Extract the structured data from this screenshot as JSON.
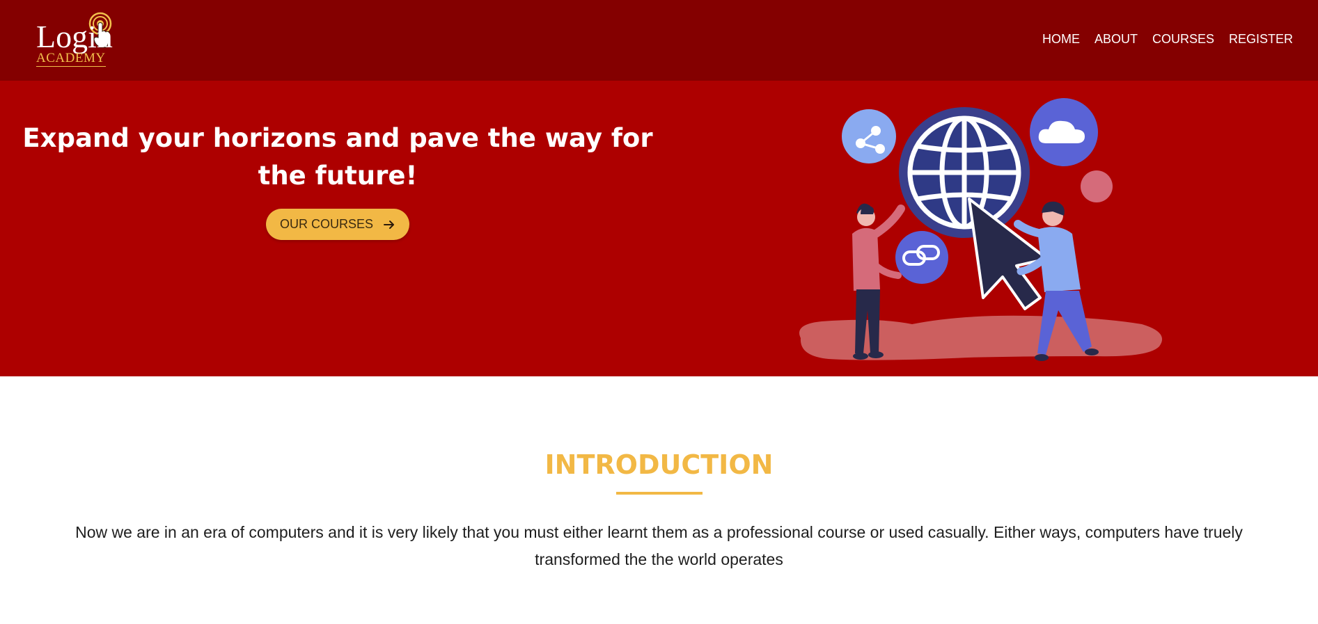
{
  "brand": {
    "logo_text": "Login",
    "logo_subtext": "ACADEMY"
  },
  "nav": {
    "items": [
      {
        "label": "HOME"
      },
      {
        "label": "ABOUT"
      },
      {
        "label": "COURSES"
      },
      {
        "label": "REGISTER"
      }
    ]
  },
  "hero": {
    "title": "Expand your horizons and pave the way for the future!",
    "cta_label": "OUR COURSES",
    "cta_icon": "arrow-right-icon"
  },
  "intro": {
    "title": "INTRODUCTION",
    "body": "Now we are in an era of computers and it is very likely that you must either learnt them as a professional course or used casually. Either ways, computers have truely transformed the the world operates"
  },
  "colors": {
    "navbar": "#840000",
    "hero": "#ad0000",
    "accent": "#f2b845",
    "text": "#1e1e1e"
  }
}
